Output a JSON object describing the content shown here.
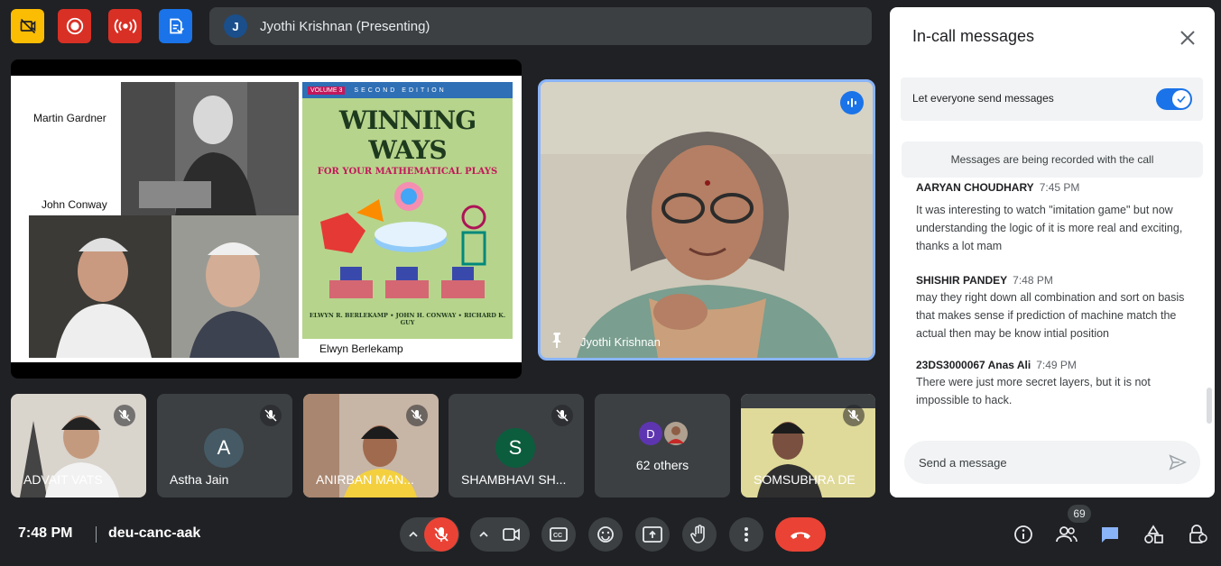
{
  "top_bar": {
    "icons": [
      "no-video-share-icon",
      "record-icon",
      "live-stream-icon",
      "transcript-icon"
    ],
    "colors": [
      "#fbbc04",
      "#d93025",
      "#d93025",
      "#1a73e8"
    ],
    "presenting_initial": "J",
    "presenting_text": "Jyothi Krishnan (Presenting)"
  },
  "slide": {
    "labels": {
      "martin": "Martin Gardner",
      "john": "John Conway",
      "elwyn": "Elwyn Berlekamp"
    },
    "book": {
      "volume": "VOLUME 3",
      "edition": "SECOND EDITION",
      "title_line1": "WINNING WAYS",
      "title_line2": "FOR YOUR MATHEMATICAL PLAYS",
      "authors": "ELWYN R. BERLEKAMP • JOHN H. CONWAY • RICHARD K. GUY"
    }
  },
  "speaker": {
    "name": "Jyothi Krishnan"
  },
  "tiles": [
    {
      "name": "ADVAIT VATS",
      "kind": "video"
    },
    {
      "name": "Astha Jain",
      "kind": "avatar",
      "initial": "A",
      "color": "#455a64"
    },
    {
      "name": "ANIRBAN MAN...",
      "kind": "video"
    },
    {
      "name": "SHAMBHAVI SH...",
      "kind": "avatar",
      "initial": "S",
      "color": "#0b5d3e"
    },
    {
      "name": "62 others",
      "kind": "others",
      "initial": "D",
      "color": "#5e35b1"
    },
    {
      "name": "SOMSUBHRA DE",
      "kind": "video"
    }
  ],
  "chat": {
    "title": "In-call messages",
    "toggle_label": "Let everyone send messages",
    "toggle_on": true,
    "recording_note": "Messages are being recorded with the call",
    "messages": [
      {
        "sender": "AARYAN CHOUDHARY",
        "time": "7:45 PM",
        "text": "It was interesting to watch \"imitation game\" but now understanding the logic of it is more real and exciting, thanks a lot mam"
      },
      {
        "sender": "SHISHIR PANDEY",
        "time": "7:48 PM",
        "text": "may they right down all combination and sort on basis that makes sense if prediction of machine match the actual then may be know  intial position"
      },
      {
        "sender": "23DS3000067 Anas Ali",
        "time": "7:49 PM",
        "text": "There were just more secret layers, but it is not impossible to hack."
      }
    ],
    "input_placeholder": "Send a message"
  },
  "bottom_bar": {
    "time": "7:48 PM",
    "meeting_code": "deu-canc-aak",
    "participant_count": "69",
    "end_call_color": "#ea4335"
  }
}
